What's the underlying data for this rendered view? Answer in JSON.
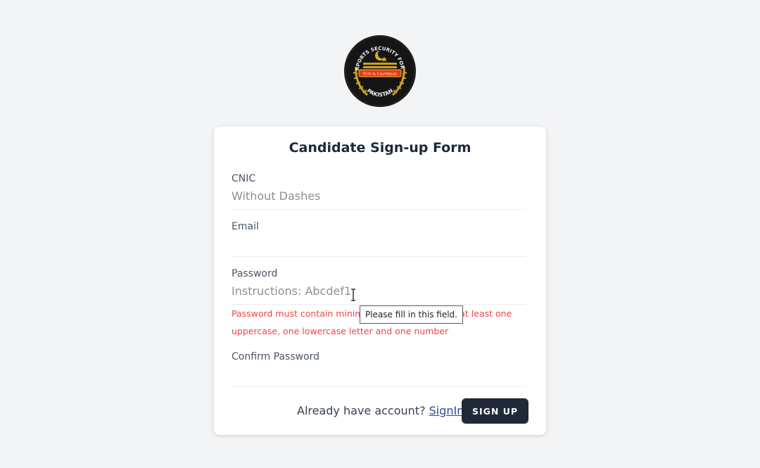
{
  "logo": {
    "top_text": "AIRPORTS",
    "arc_text": "SECURITY FORCE",
    "motto": "Firm & Courteous",
    "bottom_text": "PAKISTAN"
  },
  "form": {
    "title": "Candidate Sign-up Form",
    "cnic": {
      "label": "CNIC",
      "placeholder": "Without Dashes",
      "value": ""
    },
    "email": {
      "label": "Email",
      "placeholder": "",
      "value": ""
    },
    "password": {
      "label": "Password",
      "placeholder": "Instructions: Abcdef1",
      "value": ""
    },
    "password_error_line1": "Password must contain minimum 6 characters with at least one",
    "password_error_line2": "uppercase, one lowercase letter and one number",
    "confirm_password": {
      "label": "Confirm Password",
      "placeholder": "",
      "value": ""
    },
    "validation_tooltip": "Please fill in this field.",
    "footer": {
      "prompt": "Already have account? ",
      "signin_label": "SignIn",
      "signup_label": "SIGN UP"
    }
  },
  "colors": {
    "background": "#f3f4f6",
    "card": "#ffffff",
    "error": "#ef4444",
    "button": "#1f2937",
    "link": "#2f45a0"
  }
}
